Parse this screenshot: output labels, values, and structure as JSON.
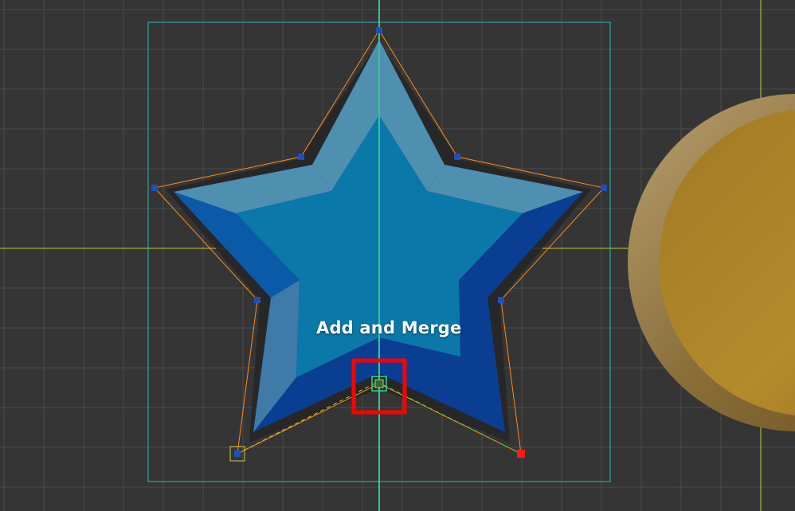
{
  "canvas": {
    "background": "#353535",
    "grid_color": "#4a4a4a",
    "axis_x_color": "#c8c83a",
    "axis_y_color": "#2fc98a"
  },
  "star": {
    "fill_light": "#2a86b8",
    "fill_mid": "#0a78a8",
    "fill_dark": "#0a3e92",
    "shadow": "#1e1e1e",
    "outline_color": "#ff8a1a"
  },
  "bounding_box": {
    "color": "#2bb6b6"
  },
  "anchor_points": {
    "color": "#1f4fb8",
    "selected_handle_color": "#ff1a1a",
    "corner_handle_color": "#c9c93a"
  },
  "highlight": {
    "color": "#ff0000",
    "target_icon": "add-and-merge-point-icon"
  },
  "tooltip": {
    "label": "Add and Merge"
  },
  "coin": {
    "rim_color": "#9a8050",
    "face_color": "#b48a2c"
  }
}
